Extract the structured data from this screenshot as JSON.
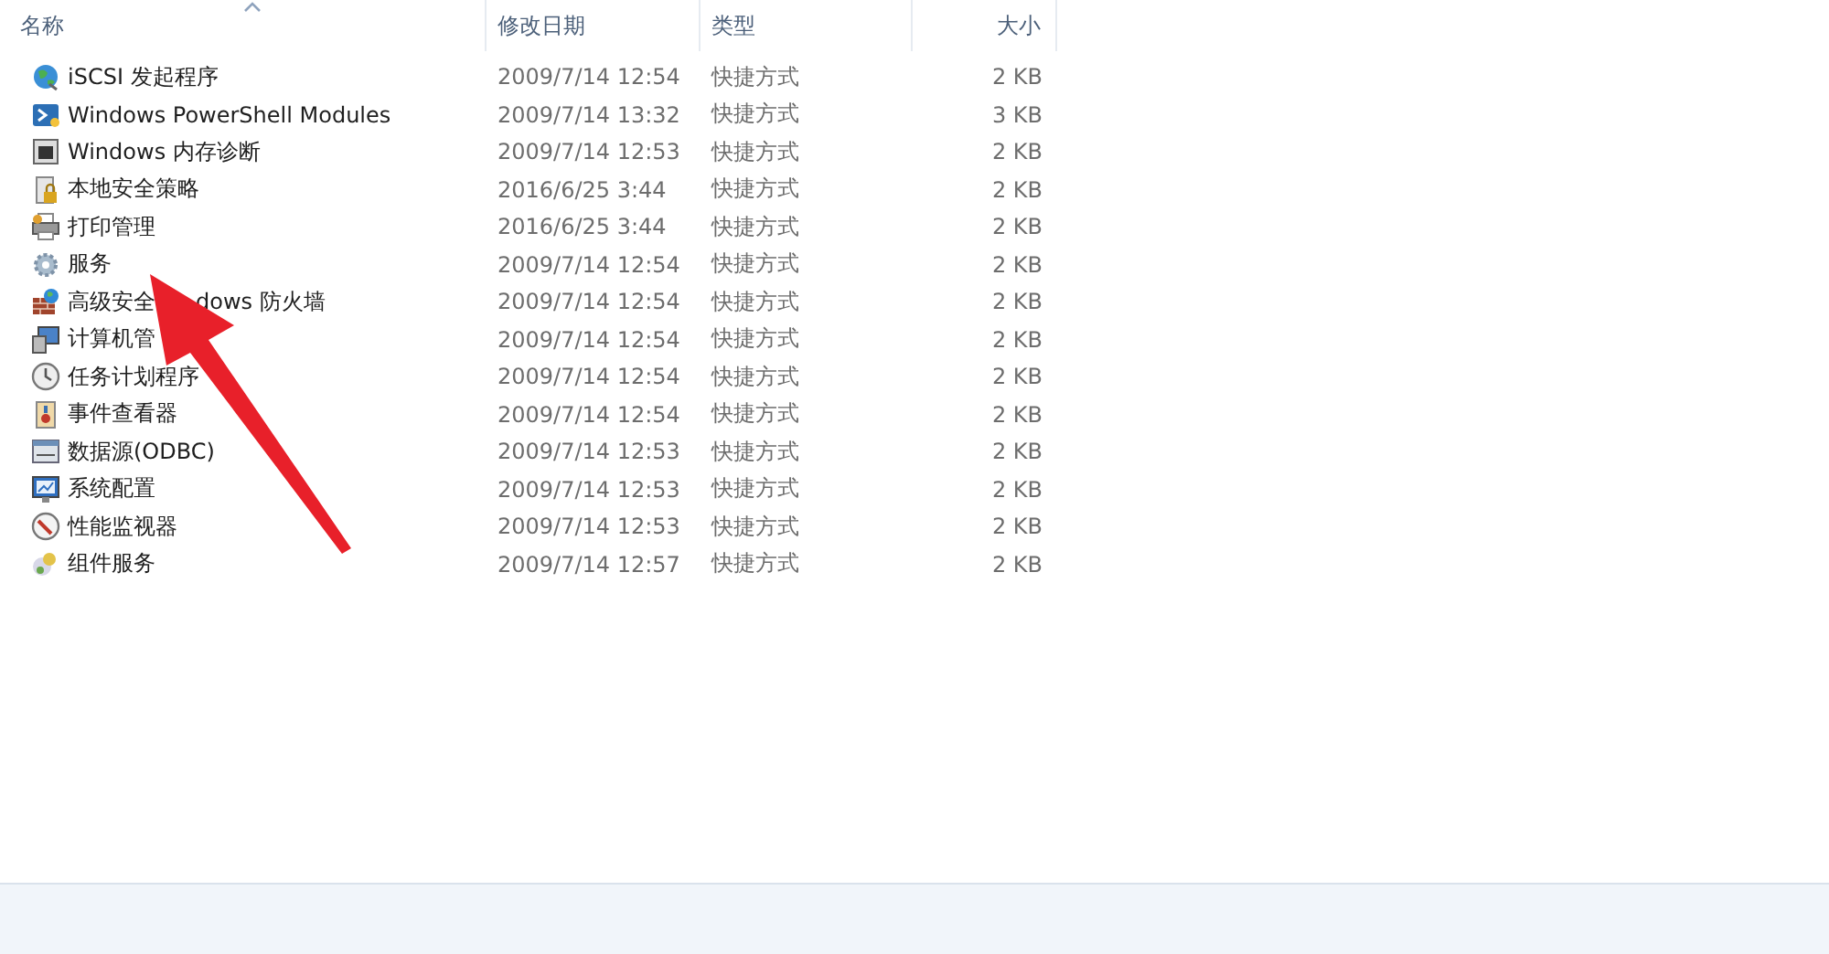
{
  "columns": [
    {
      "label": "名称",
      "sorted": true
    },
    {
      "label": "修改日期",
      "sorted": false
    },
    {
      "label": "类型",
      "sorted": false
    },
    {
      "label": "大小",
      "sorted": false
    }
  ],
  "rows": [
    {
      "name_parts": [
        "iSCSI 发起程序"
      ],
      "date": "2009/7/14 12:54",
      "type": "快捷方式",
      "size": "2 KB"
    },
    {
      "name_parts": [
        "Windows PowerShell Modules"
      ],
      "date": "2009/7/14 13:32",
      "type": "快捷方式",
      "size": "3 KB"
    },
    {
      "name_parts": [
        "Windows 内存诊断"
      ],
      "date": "2009/7/14 12:53",
      "type": "快捷方式",
      "size": "2 KB"
    },
    {
      "name_parts": [
        "本地安全策略"
      ],
      "date": "2016/6/25 3:44",
      "type": "快捷方式",
      "size": "2 KB"
    },
    {
      "name_parts": [
        "打印管理"
      ],
      "date": "2016/6/25 3:44",
      "type": "快捷方式",
      "size": "2 KB"
    },
    {
      "name_parts": [
        "服务"
      ],
      "date": "2009/7/14 12:54",
      "type": "快捷方式",
      "size": "2 KB"
    },
    {
      "name_parts": [
        "高级安全",
        "dows 防火墙"
      ],
      "date": "2009/7/14 12:54",
      "type": "快捷方式",
      "size": "2 KB"
    },
    {
      "name_parts": [
        "计算机管"
      ],
      "date": "2009/7/14 12:54",
      "type": "快捷方式",
      "size": "2 KB"
    },
    {
      "name_parts": [
        "任务计划程序"
      ],
      "date": "2009/7/14 12:54",
      "type": "快捷方式",
      "size": "2 KB"
    },
    {
      "name_parts": [
        "事件查看器"
      ],
      "date": "2009/7/14 12:54",
      "type": "快捷方式",
      "size": "2 KB"
    },
    {
      "name_parts": [
        "数据源(ODBC)"
      ],
      "date": "2009/7/14 12:53",
      "type": "快捷方式",
      "size": "2 KB"
    },
    {
      "name_parts": [
        "系统配置"
      ],
      "date": "2009/7/14 12:53",
      "type": "快捷方式",
      "size": "2 KB"
    },
    {
      "name_parts": [
        "性能监视器"
      ],
      "date": "2009/7/14 12:53",
      "type": "快捷方式",
      "size": "2 KB"
    },
    {
      "name_parts": [
        "组件服务"
      ],
      "date": "2009/7/14 12:57",
      "type": "快捷方式",
      "size": "2 KB"
    }
  ],
  "annotation": {
    "kind": "arrow"
  }
}
